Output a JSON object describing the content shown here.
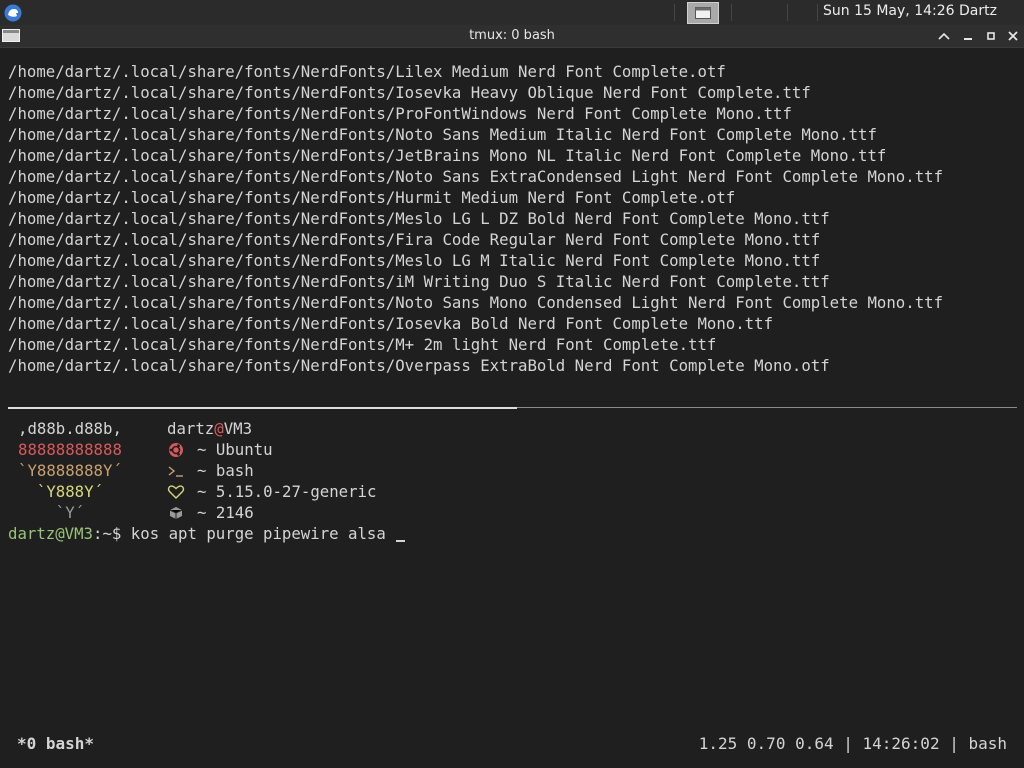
{
  "panel": {
    "clock": "Sun 15 May, 14:26",
    "user": "Dartz"
  },
  "window": {
    "title": "tmux: 0 bash"
  },
  "terminal": {
    "output_lines": [
      "/home/dartz/.local/share/fonts/NerdFonts/Lilex Medium Nerd Font Complete.otf",
      "/home/dartz/.local/share/fonts/NerdFonts/Iosevka Heavy Oblique Nerd Font Complete.ttf",
      "/home/dartz/.local/share/fonts/NerdFonts/ProFontWindows Nerd Font Complete Mono.ttf",
      "/home/dartz/.local/share/fonts/NerdFonts/Noto Sans Medium Italic Nerd Font Complete Mono.ttf",
      "/home/dartz/.local/share/fonts/NerdFonts/JetBrains Mono NL Italic Nerd Font Complete Mono.ttf",
      "/home/dartz/.local/share/fonts/NerdFonts/Noto Sans ExtraCondensed Light Nerd Font Complete Mono.ttf",
      "/home/dartz/.local/share/fonts/NerdFonts/Hurmit Medium Nerd Font Complete.otf",
      "/home/dartz/.local/share/fonts/NerdFonts/Meslo LG L DZ Bold Nerd Font Complete Mono.ttf",
      "/home/dartz/.local/share/fonts/NerdFonts/Fira Code Regular Nerd Font Complete Mono.ttf",
      "/home/dartz/.local/share/fonts/NerdFonts/Meslo LG M Italic Nerd Font Complete Mono.ttf",
      "/home/dartz/.local/share/fonts/NerdFonts/iM Writing Duo S Italic Nerd Font Complete.ttf",
      "/home/dartz/.local/share/fonts/NerdFonts/Noto Sans Mono Condensed Light Nerd Font Complete Mono.ttf",
      "/home/dartz/.local/share/fonts/NerdFonts/Iosevka Bold Nerd Font Complete Mono.ttf",
      "/home/dartz/.local/share/fonts/NerdFonts/M+ 2m light Nerd Font Complete.ttf",
      "/home/dartz/.local/share/fonts/NerdFonts/Overpass ExtraBold Nerd Font Complete Mono.otf"
    ],
    "fetch": {
      "art": [
        {
          "text": ",d88b.d88b,",
          "color": "#d4d4d4"
        },
        {
          "text": "88888888888",
          "color": "#d9585b"
        },
        {
          "text": "`Y8888888Y´",
          "color": "#c8a070"
        },
        {
          "text": "  `Y888Y´",
          "color": "#d7d77a"
        },
        {
          "text": "    `Y´",
          "color": "#9a9a9a"
        }
      ],
      "user": "dartz",
      "at": "@",
      "host": "VM3",
      "rows": [
        {
          "icon": "ubuntu-icon",
          "icon_color": "#d9585b",
          "text": "~ Ubuntu"
        },
        {
          "icon": "terminal-icon",
          "icon_color": "#c8a070",
          "text": "~ bash"
        },
        {
          "icon": "heart-icon",
          "icon_color": "#d7d77a",
          "text": "~ 5.15.0-27-generic"
        },
        {
          "icon": "package-icon",
          "icon_color": "#9a9a9a",
          "text": "~ 2146"
        }
      ]
    },
    "prompt": {
      "user_host": "dartz@VM3",
      "path": ":~$",
      "command": " kos apt purge pipewire alsa "
    }
  },
  "status_bar": {
    "window": "*0 bash*",
    "right": "1.25 0.70 0.64 | 14:26:02 | bash"
  },
  "colors": {
    "prompt_green": "#98c379",
    "text": "#d4d4d4",
    "background": "#1f1f1f"
  }
}
